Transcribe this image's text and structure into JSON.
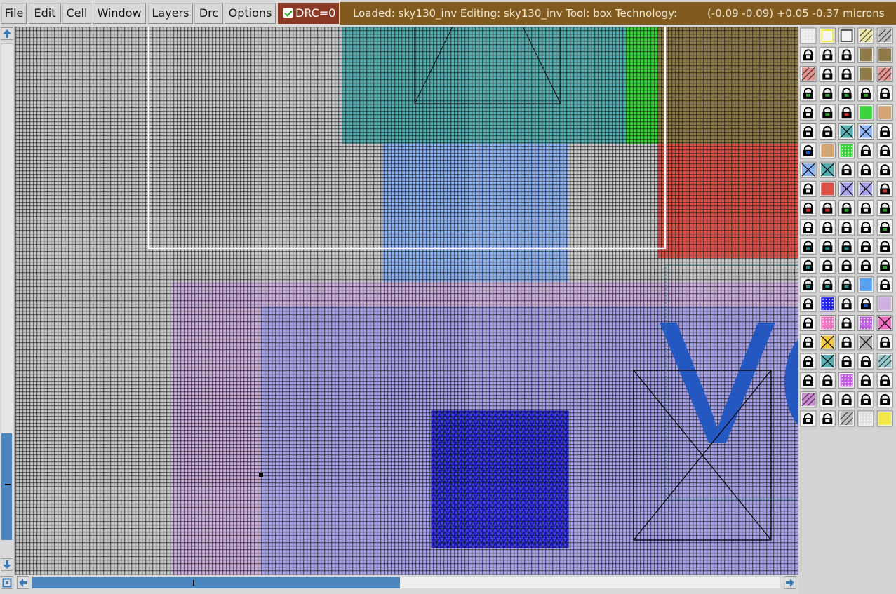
{
  "menu": {
    "items": [
      "File",
      "Edit",
      "Cell",
      "Window",
      "Layers",
      "Drc",
      "Options"
    ]
  },
  "drc": {
    "label": "DRC=0",
    "checked": true
  },
  "status": {
    "text": "Loaded: sky130_inv Editing: sky130_inv Tool: box  Technology:",
    "coordinates": "(-0.09 -0.09) +0.05 -0.37 microns"
  },
  "canvas": {
    "label_text": "VG",
    "colors": {
      "background": "#c9c9cc",
      "grid": "#141414",
      "diffusion": "#56aeb0",
      "poly_green": "#3ad23a",
      "brown": "#8e7a48",
      "red": "#dd5048",
      "light_blue": "#8fb4f4",
      "well_pink": "#cdb0de",
      "metal_purple": "#a9a3ec",
      "contact_blue": "#2020f0",
      "label_blue": "#2458c0",
      "selection_box": "#ffffff"
    }
  },
  "palette": {
    "column_count": 5,
    "row_count": 21,
    "tile_kinds": [
      "grid,yellow-empty,dark-empty,yellow-hatch,gray-hatch",
      "lock,lock,lock,brown,brown",
      "red-hatch,lock,lock,brown,red-hatch",
      "lock-green,lock-green,lock-green,lock-green,lock",
      "lock,lock-green,lock-red,green,tan",
      "lock,lock,x-teal,x-blue,lock",
      "lock-blue,tan,green-dots,lock,lock",
      "x-blue,x-teal,lock,lock,lock",
      "lock,red,x-purple,x-purple,lock-red",
      "lock-red,lock-red,lock-green,lock,lock-green",
      "lock,lock,lock,lock,lock-green",
      "lock-teal,lock-teal,lock-teal,lock,lock",
      "lock-teal,lock,lock,lock,lock-green",
      "lock-teal,lock-teal,lock-teal,blue-wave,lock",
      "lock,blue-dots,lock,lock-blue,lilac",
      "lock,pink-dots,lock,purple-dots,pink-x",
      "lock,yellow-x,lock,gray-x,lock",
      "lock,x-teal,lock,lock,teal-hatch",
      "lock,lock,purple-dots,lock,lock",
      "purple-hatch,lock,lock,lock,lock",
      "lock,lock,gray-hatch,dots,yellow"
    ]
  }
}
